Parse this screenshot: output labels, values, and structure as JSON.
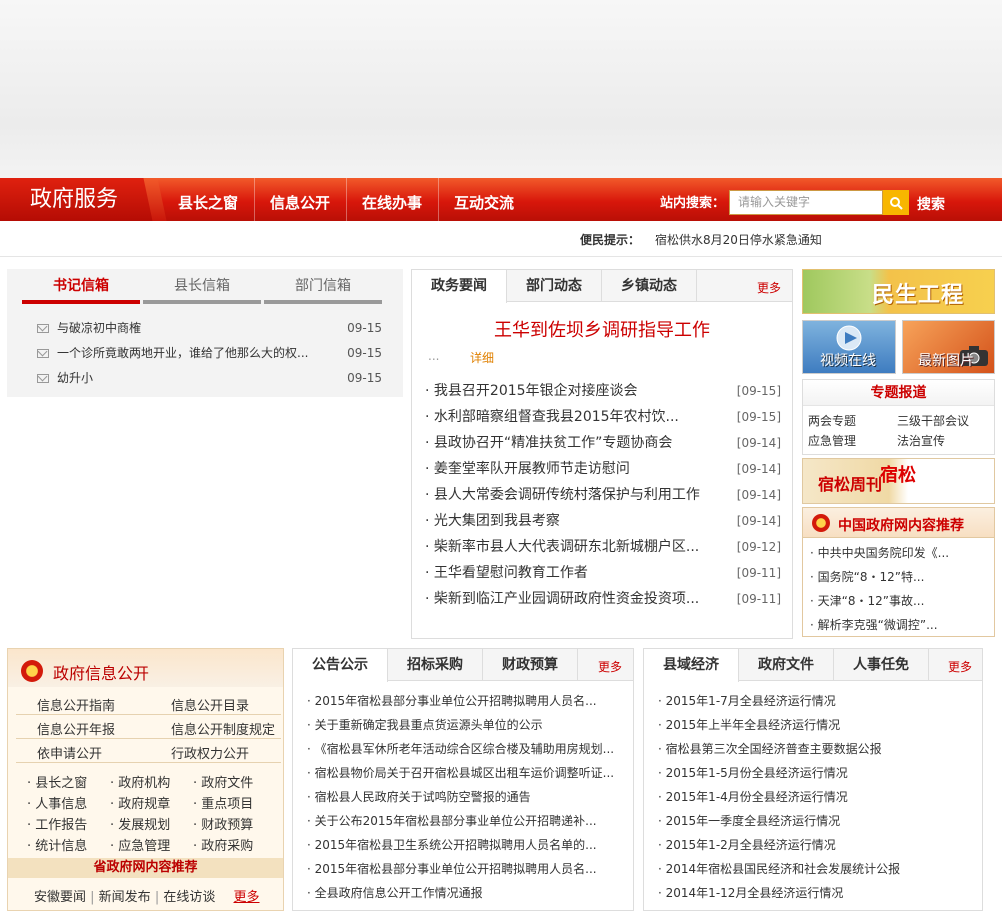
{
  "nav": {
    "brand": "政府服务",
    "items": [
      "县长之窗",
      "信息公开",
      "在线办事",
      "互动交流"
    ],
    "search_label": "站内搜索：",
    "search_placeholder": "请输入关键字",
    "search_button": "搜索"
  },
  "notice": {
    "label": "便民提示：",
    "text": "宿松供水8月20日停水紧急通知"
  },
  "mailbox": {
    "tabs": [
      "书记信箱",
      "县长信箱",
      "部门信箱"
    ],
    "items": [
      {
        "text": "与破凉初中商榷",
        "date": "09-15"
      },
      {
        "text": "一个诊所竟敢两地开业，谁给了他那么大的权...",
        "date": "09-15"
      },
      {
        "text": "幼升小",
        "date": "09-15"
      }
    ]
  },
  "news": {
    "tabs": [
      "政务要闻",
      "部门动态",
      "乡镇动态"
    ],
    "more": "更多",
    "headline": "王华到佐坝乡调研指导工作",
    "headline_dots": "...",
    "headline_detail": "详细",
    "items": [
      {
        "text": "我县召开2015年银企对接座谈会",
        "date": "[09-15]"
      },
      {
        "text": "水利部暗察组督查我县2015年农村饮...",
        "date": "[09-15]"
      },
      {
        "text": "县政协召开“精准扶贫工作”专题协商会",
        "date": "[09-14]"
      },
      {
        "text": "姜奎堂率队开展教师节走访慰问",
        "date": "[09-14]"
      },
      {
        "text": "县人大常委会调研传统村落保护与利用工作",
        "date": "[09-14]"
      },
      {
        "text": "光大集团到我县考察",
        "date": "[09-14]"
      },
      {
        "text": "柴新率市县人大代表调研东北新城棚户区...",
        "date": "[09-12]"
      },
      {
        "text": "王华看望慰问教育工作者",
        "date": "[09-11]"
      },
      {
        "text": "柴新到临江产业园调研政府性资金投资项...",
        "date": "[09-11]"
      }
    ]
  },
  "right": {
    "minsheng": "民生工程",
    "video": "视频在线",
    "photos": "最新图片",
    "topics_title": "专题报道",
    "topics": [
      "两会专题",
      "三级干部会议",
      "应急管理",
      "法治宣传"
    ],
    "weekly": "宿松周刊",
    "weekly_red": "宿松",
    "cgov_title": "中国政府网内容推荐",
    "cgov_items": [
      "中共中央国务院印发《...",
      "国务院“8・12”特...",
      "天津“8・12”事故...",
      "解析李克强“微调控”..."
    ]
  },
  "gov": {
    "title": "政府信息公开",
    "main_links": [
      [
        "信息公开指南",
        "信息公开目录"
      ],
      [
        "信息公开年报",
        "信息公开制度规定"
      ],
      [
        "依申请公开",
        "行政权力公开"
      ]
    ],
    "small_links": [
      [
        "县长之窗",
        "政府机构",
        "政府文件"
      ],
      [
        "人事信息",
        "政府规章",
        "重点项目"
      ],
      [
        "工作报告",
        "发展规划",
        "财政预算"
      ],
      [
        "统计信息",
        "应急管理",
        "政府采购"
      ]
    ],
    "prov_title": "省政府网内容推荐",
    "prov_links": [
      "安徽要闻",
      "新闻发布",
      "在线访谈"
    ],
    "prov_more": "更多"
  },
  "notice_panel": {
    "tabs": [
      "公告公示",
      "招标采购",
      "财政预算"
    ],
    "more": "更多",
    "items": [
      "2015年宿松县部分事业单位公开招聘拟聘用人员名...",
      "关于重新确定我县重点货运源头单位的公示",
      "《宿松县军休所老年活动综合区综合楼及辅助用房规划...",
      "宿松县物价局关于召开宿松县城区出租车运价调整听证...",
      "宿松县人民政府关于试鸣防空警报的通告",
      "关于公布2015年宿松县部分事业单位公开招聘递补...",
      "2015年宿松县卫生系统公开招聘拟聘用人员名单的...",
      "2015年宿松县部分事业单位公开招聘拟聘用人员名...",
      "全县政府信息公开工作情况通报"
    ]
  },
  "economy_panel": {
    "tabs": [
      "县域经济",
      "政府文件",
      "人事任免"
    ],
    "more": "更多",
    "items": [
      "2015年1-7月全县经济运行情况",
      "2015年上半年全县经济运行情况",
      "宿松县第三次全国经济普查主要数据公报",
      "2015年1-5月份全县经济运行情况",
      "2015年1-4月份全县经济运行情况",
      "2015年一季度全县经济运行情况",
      "2015年1-2月全县经济运行情况",
      "2014年宿松县国民经济和社会发展统计公报",
      "2014年1-12月全县经济运行情况"
    ]
  }
}
